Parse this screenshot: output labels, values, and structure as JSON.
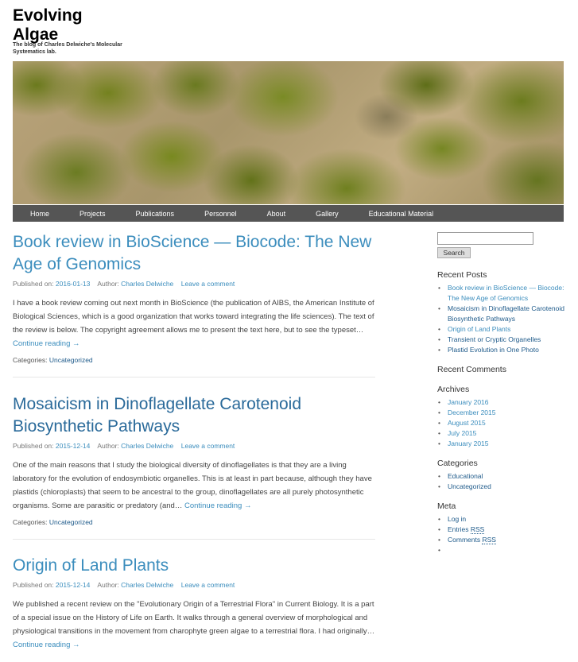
{
  "site": {
    "title": "Evolving Algae",
    "description": "The blog of Charles Delwiche's Molecular Systematics lab."
  },
  "nav": [
    "Home",
    "Projects",
    "Publications",
    "Personnel",
    "About",
    "Gallery",
    "Educational Material"
  ],
  "posts": [
    {
      "title": "Book review in BioScience — Biocode: The New Age of Genomics",
      "published_label": "Published on:",
      "date": "2016-01-13",
      "author_label": "Author:",
      "author": "Charles Delwiche",
      "comment_link": "Leave a comment",
      "excerpt": "I have a book review coming out next month in BioScience (the publication of AIBS, the American Institute of Biological Sciences, which is a good organization that works toward integrating the life sciences). The text of the review is below. The copyright agreement allows me to present the text here, but to see the typeset…",
      "more": "Continue reading →",
      "categories_label": "Categories:",
      "category": "Uncategorized"
    },
    {
      "title": "Mosaicism in Dinoflagellate Carotenoid Biosynthetic Pathways",
      "published_label": "Published on:",
      "date": "2015-12-14",
      "author_label": "Author:",
      "author": "Charles Delwiche",
      "comment_link": "Leave a comment",
      "excerpt": "One of the main reasons that I study the biological diversity of dinoflagellates is that they are a living laboratory for the evolution of endosymbiotic organelles. This is at least in part because, although they have plastids (chloroplasts) that seem to be ancestral to the group, dinoflagellates are all purely photosynthetic organisms. Some are parasitic or predatory (and…",
      "more": "Continue reading →",
      "categories_label": "Categories:",
      "category": "Uncategorized"
    },
    {
      "title": "Origin of Land Plants",
      "published_label": "Published on:",
      "date": "2015-12-14",
      "author_label": "Author:",
      "author": "Charles Delwiche",
      "comment_link": "Leave a comment",
      "excerpt": "We published a recent review on the \"Evolutionary Origin of a Terrestrial Flora\" in Current Biology. It is a part of a special issue on the History of Life on Earth. It walks through a general overview of morphological and physiological transitions in the movement from charophyte green algae to a terrestrial flora. I had originally…",
      "more": "Continue reading →"
    }
  ],
  "sidebar": {
    "search_button": "Search",
    "search_value": "",
    "recent_posts_title": "Recent Posts",
    "recent_posts": [
      "Book review in BioScience — Biocode: The New Age of Genomics",
      "Mosaicism in Dinoflagellate Carotenoid Biosynthetic Pathways",
      "Origin of Land Plants",
      "Transient or Cryptic Organelles",
      "Plastid Evolution in One Photo"
    ],
    "recent_comments_title": "Recent Comments",
    "archives_title": "Archives",
    "archives": [
      "January 2016",
      "December 2015",
      "August 2015",
      "July 2015",
      "January 2015"
    ],
    "categories_title": "Categories",
    "categories": [
      "Educational",
      "Uncategorized"
    ],
    "meta_title": "Meta",
    "meta": {
      "login": "Log in",
      "entries_prefix": "Entries",
      "comments_prefix": "Comments",
      "rss": "RSS",
      "empty": ""
    }
  },
  "colors": {
    "link": "#3b8dbd",
    "dark_link": "#1e5a8a",
    "nav_bg": "#555555"
  },
  "banner_image": "green algae on sand"
}
